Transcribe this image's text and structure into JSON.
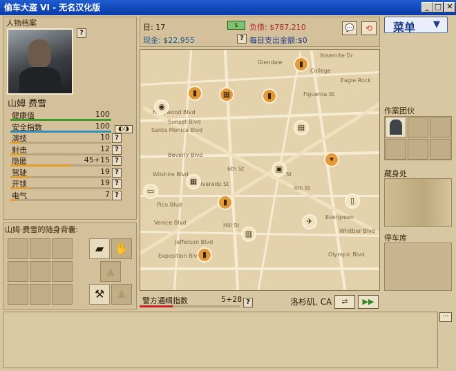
{
  "window": {
    "title": "偷车大盗 VI - 无名汉化版",
    "min": "_",
    "max": "□",
    "close": "✕"
  },
  "profile": {
    "section_label": "人物档案",
    "help": "?",
    "name": "山姆 费雪",
    "stats": [
      {
        "label": "健康值",
        "value": "100",
        "fill": 1.0,
        "color": "#3f9a2a"
      },
      {
        "label": "安全指数",
        "value": "100",
        "fill": 1.0,
        "color": "#2f8fb8"
      },
      {
        "label": "演技",
        "value": "10",
        "fill": 0.1,
        "color": "#e0a030"
      },
      {
        "label": "射击",
        "value": "12",
        "fill": 0.12,
        "color": "#e0a030"
      },
      {
        "label": "隐匿",
        "value": "45+15",
        "fill": 0.6,
        "color": "#e0a030"
      },
      {
        "label": "驾驶",
        "value": "19",
        "fill": 0.19,
        "color": "#e0a030"
      },
      {
        "label": "开锁",
        "value": "19",
        "fill": 0.19,
        "color": "#e0a030"
      },
      {
        "label": "电气",
        "value": "7",
        "fill": 0.07,
        "color": "#e0a030"
      }
    ]
  },
  "backpack": {
    "label": "山姆·费雪的随身背囊:"
  },
  "info": {
    "day": "日: 17",
    "debt": "负债: $787,210",
    "cash": "现金: $22,955",
    "daily": "每日支出金额:$0",
    "help": "?"
  },
  "menu": {
    "label": "菜单",
    "arrow": "▼"
  },
  "map": {
    "labels": [
      "Hollywood Blvd",
      "Sunset Blvd",
      "Santa Monica Blvd",
      "Beverly Blvd",
      "Wilshire Blvd",
      "Pico Blvd",
      "Venice Blvd",
      "Jefferson Blvd",
      "Exposition Blvd",
      "Glendale",
      "Yosemite Dr",
      "College",
      "Figueroa St",
      "Eagle Rock",
      "Olympic Blvd",
      "Evergreen",
      "Whittier Blvd",
      "Hill St",
      "Alvarado St",
      "6th St",
      "1st St",
      "4th St"
    ]
  },
  "wanted": {
    "label": "警方通缉指数",
    "value": "5+28",
    "fill": 0.33,
    "help": "?"
  },
  "location": {
    "city": "洛杉矶, CA"
  },
  "right": {
    "crew": "作案团伙",
    "hideout": "藏身处",
    "garage": "停车库"
  },
  "log": {
    "more": "···"
  }
}
